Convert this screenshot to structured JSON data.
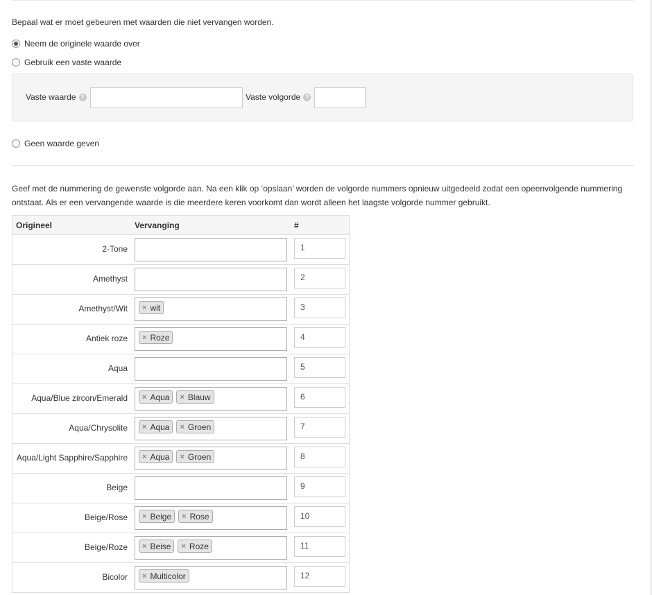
{
  "intro_text": "Bepaal wat er moet gebeuren met waarden die niet vervangen worden.",
  "options": [
    {
      "label": "Neem de originele waarde over",
      "checked": true
    },
    {
      "label": "Gebruik een vaste waarde",
      "checked": false
    },
    {
      "label": "Geen waarde geven",
      "checked": false
    }
  ],
  "fixed": {
    "value_label": "Vaste waarde",
    "order_label": "Vaste volgorde",
    "value": "",
    "order": "",
    "help_icon": "?"
  },
  "description": "Geef met de nummering de gewenste volgorde aan. Na een klik op ‘opslaan’ worden de volgorde nummers opnieuw uitgedeeld zodat een opeenvolgende nummering ontstaat. Als er een vervangende waarde is die meerdere keren voorkomt dan wordt alleen het laagste volgorde nummer gebruikt.",
  "table": {
    "headers": {
      "original": "Origineel",
      "replacement": "Vervanging",
      "order": "#"
    },
    "tag_remove": "×",
    "rows": [
      {
        "original": "2-Tone",
        "tags": [],
        "order": "1"
      },
      {
        "original": "Amethyst",
        "tags": [],
        "order": "2"
      },
      {
        "original": "Amethyst/Wit",
        "tags": [
          "wit"
        ],
        "order": "3"
      },
      {
        "original": "Antiek roze",
        "tags": [
          "Roze"
        ],
        "order": "4"
      },
      {
        "original": "Aqua",
        "tags": [],
        "order": "5"
      },
      {
        "original": "Aqua/Blue zircon/Emerald",
        "tags": [
          "Aqua",
          "Blauw"
        ],
        "order": "6"
      },
      {
        "original": "Aqua/Chrysolite",
        "tags": [
          "Aqua",
          "Groen"
        ],
        "order": "7"
      },
      {
        "original": "Aqua/Light Sapphire/Sapphire",
        "tags": [
          "Aqua",
          "Groen"
        ],
        "order": "8"
      },
      {
        "original": "Beige",
        "tags": [],
        "order": "9"
      },
      {
        "original": "Beige/Rose",
        "tags": [
          "Beige",
          "Rose"
        ],
        "order": "10"
      },
      {
        "original": "Beige/Roze",
        "tags": [
          "Beise",
          "Roze"
        ],
        "order": "11"
      },
      {
        "original": "Bicolor",
        "tags": [
          "Multicolor"
        ],
        "order": "12"
      }
    ]
  }
}
